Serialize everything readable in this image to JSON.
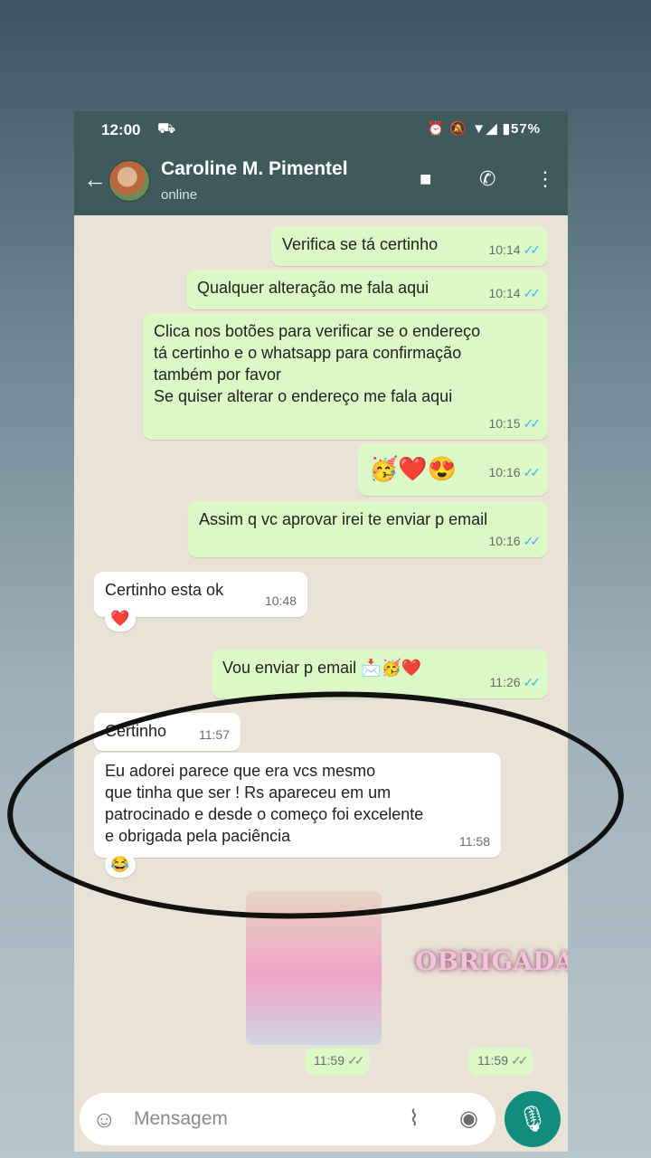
{
  "status": {
    "time": "12:00",
    "left_icon": "⛟",
    "right_icons": "⏰ 🔕 ▼◢ ▮57%",
    "battery": "57%"
  },
  "header": {
    "back": "←",
    "name": "Caroline M. Pimentel",
    "status": "online",
    "video_icon": "■",
    "call_icon": "✆",
    "more_icon": "⋮"
  },
  "messages": [
    {
      "text": "Verifica se tá certinho",
      "time": "10:14"
    },
    {
      "text": "Qualquer alteração me fala aqui",
      "time": "10:14"
    },
    {
      "line1": "Clica nos botões para verificar se o endereço",
      "line2": "tá certinho e o whatsapp para confirmação",
      "line3": "também por favor",
      "line4": "Se quiser alterar o endereço me fala aqui",
      "time": "10:15"
    },
    {
      "text": "🥳❤️😍",
      "time": "10:16"
    },
    {
      "text": "Assim q vc aprovar irei te enviar p email",
      "time": "10:16"
    },
    {
      "text": "Certinho esta ok",
      "time": "10:48",
      "reaction": "❤️"
    },
    {
      "text": "Vou enviar p email 📩🥳❤️",
      "time": "11:26"
    },
    {
      "text": "Certinho",
      "time": "11:57"
    },
    {
      "line1": "Eu adorei parece que era vcs mesmo",
      "line2": "que tinha que ser ! Rs apareceu em um",
      "line3": "patrocinado e desde o começo foi excelente",
      "line4": "e obrigada pela paciência",
      "time": "11:58",
      "reaction": "😂"
    }
  ],
  "sticker": {
    "caption": "OBRIGADA",
    "time_left": "11:59",
    "time_right": "11:59"
  },
  "composer": {
    "placeholder": "Mensagem",
    "emoji_icon": "☺",
    "attach_icon": "⌇",
    "camera_icon": "◉",
    "mic_icon": "🎙"
  },
  "ticks": "✓✓"
}
